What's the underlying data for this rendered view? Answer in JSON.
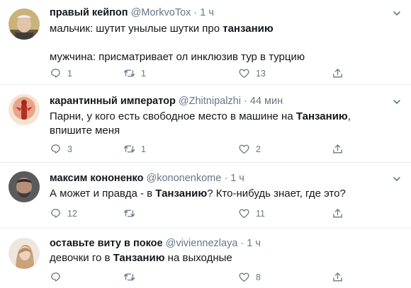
{
  "tweets": [
    {
      "name": "правый кейпоп",
      "handle": "@MorkvoTox",
      "sep": "·",
      "time": "1 ч",
      "line1_pre": "мальчик: шутит унылые шутки про ",
      "line1_bold": "танзанию",
      "line1_post": "",
      "line2": "мужчина: присматривает ол инклюзив тур в турцию",
      "replies": "1",
      "retweets": "1",
      "likes": "13"
    },
    {
      "name": "карантинный император",
      "handle": "@Zhitnipalzhi",
      "sep": "·",
      "time": "44 мин",
      "line1_pre": "Парни, у кого есть свободное место в машине на ",
      "line1_bold": "Танзанию",
      "line1_post": ", впишите меня",
      "replies": "3",
      "retweets": "1",
      "likes": "2"
    },
    {
      "name": "максим кононенко",
      "handle": "@kononenkome",
      "sep": "·",
      "time": "1 ч",
      "line1_pre": "А может и правда - в ",
      "line1_bold": "Танзанию",
      "line1_post": "? Кто-нибудь знает, где это?",
      "replies": "12",
      "retweets": "",
      "likes": "11"
    },
    {
      "name": "оставьте виту в покое",
      "handle": "@viviennezlaya",
      "sep": "·",
      "time": "1 ч",
      "line1_pre": "девочки го в ",
      "line1_bold": "Танзанию",
      "line1_post": " на выходные",
      "replies": "",
      "retweets": "",
      "likes": "8"
    }
  ],
  "icons": {
    "reply": "reply-icon",
    "retweet": "retweet-icon",
    "like": "heart-icon",
    "share": "share-icon",
    "menu": "chevron-down-icon"
  },
  "colors": {
    "text": "#14171a",
    "secondary": "#657786",
    "divider": "#e6ecf0"
  }
}
